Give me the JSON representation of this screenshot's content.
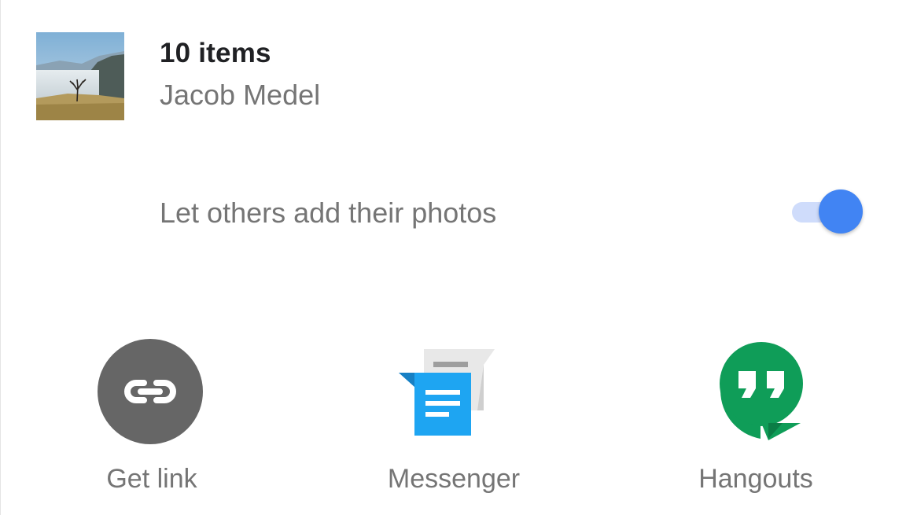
{
  "album": {
    "title": "10 items",
    "owner": "Jacob Medel",
    "thumbnail_icon": "landscape-photo-thumbnail"
  },
  "collaboration": {
    "label": "Let others add their photos",
    "enabled": true,
    "accent_color": "#4184f3"
  },
  "share_targets": [
    {
      "label": "Get link",
      "icon": "link-icon",
      "color": "#666666"
    },
    {
      "label": "Messenger",
      "icon": "messenger-icon",
      "color": "#1ea5f2"
    },
    {
      "label": "Hangouts",
      "icon": "hangouts-icon",
      "color": "#0f9d58"
    }
  ]
}
